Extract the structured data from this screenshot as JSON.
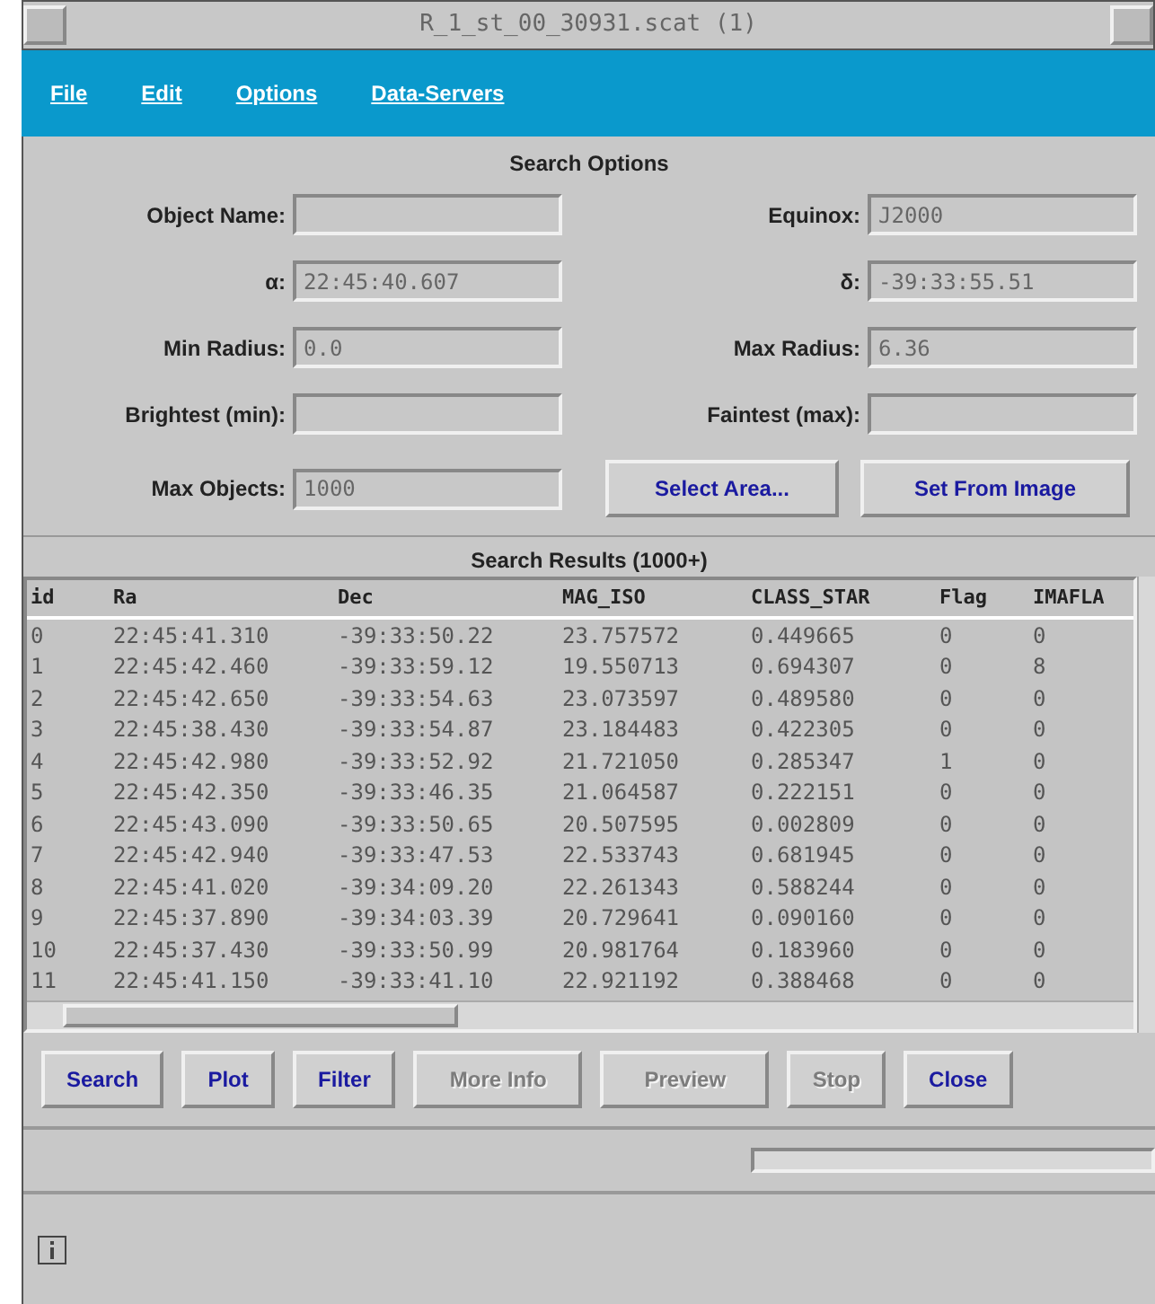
{
  "window": {
    "title": "R_1_st_00_30931.scat (1)"
  },
  "menu": [
    "File",
    "Edit",
    "Options",
    "Data-Servers"
  ],
  "search_options": {
    "title": "Search Options",
    "fields": [
      {
        "label": "Object Name:"
      },
      {
        "label": "Equinox:",
        "value": "J2000"
      },
      {
        "label": "α:",
        "value": "22:45:40.607"
      },
      {
        "label": "δ:",
        "value": "-39:33:55.51"
      },
      {
        "label": "Min Radius:",
        "value": "0.0"
      },
      {
        "label": "Max Radius:",
        "value": "6.36"
      },
      {
        "label": "Brightest (min):"
      },
      {
        "label": "Faintest (max):"
      }
    ],
    "max_objects": {
      "label": "Max Objects:",
      "value": "1000"
    },
    "buttons": [
      "Select Area...",
      "Set From Image"
    ]
  },
  "results": {
    "title": "Search Results (1000+)",
    "columns": [
      "id",
      "Ra",
      "Dec",
      "MAG_ISO",
      "CLASS_STAR",
      "Flag",
      "IMAFLA"
    ],
    "rows": [
      [
        "0",
        "22:45:41.310",
        "-39:33:50.22",
        "23.757572",
        "0.449665",
        "0",
        "0"
      ],
      [
        "1",
        "22:45:42.460",
        "-39:33:59.12",
        "19.550713",
        "0.694307",
        "0",
        "8"
      ],
      [
        "2",
        "22:45:42.650",
        "-39:33:54.63",
        "23.073597",
        "0.489580",
        "0",
        "0"
      ],
      [
        "3",
        "22:45:38.430",
        "-39:33:54.87",
        "23.184483",
        "0.422305",
        "0",
        "0"
      ],
      [
        "4",
        "22:45:42.980",
        "-39:33:52.92",
        "21.721050",
        "0.285347",
        "1",
        "0"
      ],
      [
        "5",
        "22:45:42.350",
        "-39:33:46.35",
        "21.064587",
        "0.222151",
        "0",
        "0"
      ],
      [
        "6",
        "22:45:43.090",
        "-39:33:50.65",
        "20.507595",
        "0.002809",
        "0",
        "0"
      ],
      [
        "7",
        "22:45:42.940",
        "-39:33:47.53",
        "22.533743",
        "0.681945",
        "0",
        "0"
      ],
      [
        "8",
        "22:45:41.020",
        "-39:34:09.20",
        "22.261343",
        "0.588244",
        "0",
        "0"
      ],
      [
        "9",
        "22:45:37.890",
        "-39:34:03.39",
        "20.729641",
        "0.090160",
        "0",
        "0"
      ],
      [
        "10",
        "22:45:37.430",
        "-39:33:50.99",
        "20.981764",
        "0.183960",
        "0",
        "0"
      ],
      [
        "11",
        "22:45:41.150",
        "-39:33:41.10",
        "22.921192",
        "0.388468",
        "0",
        "0"
      ]
    ]
  },
  "actions": [
    {
      "label": "Search",
      "disabled": false
    },
    {
      "label": "Plot",
      "disabled": false
    },
    {
      "label": "Filter",
      "disabled": false
    },
    {
      "label": "More Info",
      "disabled": true
    },
    {
      "label": "Preview",
      "disabled": true
    },
    {
      "label": "Stop",
      "disabled": true
    },
    {
      "label": "Close",
      "disabled": false
    }
  ]
}
